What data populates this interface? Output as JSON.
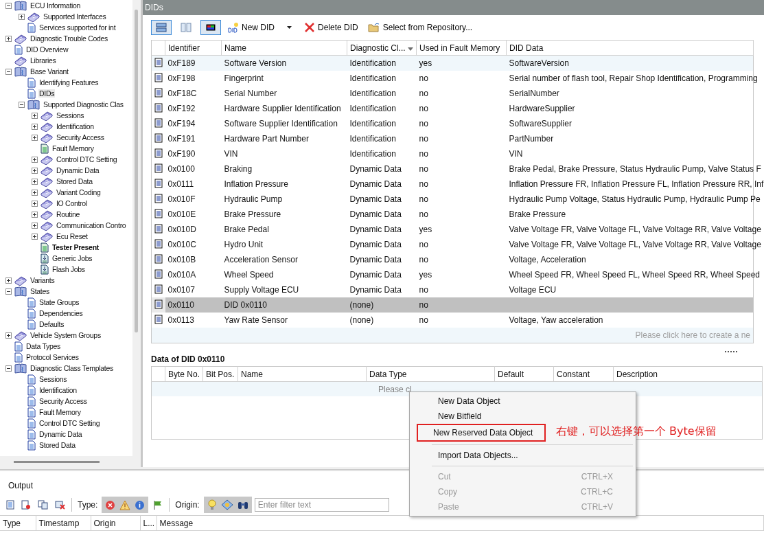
{
  "tree": [
    {
      "label": "ECU Information",
      "kind": "book-open",
      "expanded": true,
      "bold": false,
      "selected": false,
      "children": [
        {
          "label": "Supported Interfaces",
          "kind": "book",
          "expanded": false,
          "bold": false,
          "selected": false
        },
        {
          "label": "Services supported for int",
          "kind": "doc",
          "bold": false,
          "selected": false
        }
      ]
    },
    {
      "label": "Diagnostic Trouble Codes",
      "kind": "book",
      "expanded": false,
      "bold": false,
      "selected": false
    },
    {
      "label": "DID Overview",
      "kind": "doc",
      "bold": false,
      "selected": false
    },
    {
      "label": "Libraries",
      "kind": "book",
      "bold": false,
      "selected": false
    },
    {
      "label": "Base Variant",
      "kind": "book-open",
      "expanded": true,
      "bold": false,
      "selected": false,
      "children": [
        {
          "label": "Identifying Features",
          "kind": "doc",
          "bold": false,
          "selected": false
        },
        {
          "label": "DIDs",
          "kind": "doc",
          "bold": false,
          "selected": true
        },
        {
          "label": "Supported Diagnostic Clas",
          "kind": "book-open",
          "expanded": true,
          "bold": false,
          "selected": false,
          "children": [
            {
              "label": "Sessions",
              "kind": "book",
              "expanded": false,
              "bold": false,
              "selected": false
            },
            {
              "label": "Identification",
              "kind": "book",
              "expanded": false,
              "bold": false,
              "selected": false
            },
            {
              "label": "Security Access",
              "kind": "book",
              "expanded": false,
              "bold": false,
              "selected": false
            },
            {
              "label": "Fault Memory",
              "kind": "doc-green",
              "bold": false,
              "selected": false
            },
            {
              "label": "Control DTC Setting",
              "kind": "book",
              "expanded": false,
              "bold": false,
              "selected": false
            },
            {
              "label": "Dynamic Data",
              "kind": "book",
              "expanded": false,
              "bold": false,
              "selected": false
            },
            {
              "label": "Stored Data",
              "kind": "book",
              "expanded": false,
              "bold": false,
              "selected": false
            },
            {
              "label": "Variant Coding",
              "kind": "book",
              "expanded": false,
              "bold": false,
              "selected": false
            },
            {
              "label": "IO Control",
              "kind": "book",
              "expanded": false,
              "bold": false,
              "selected": false
            },
            {
              "label": "Routine",
              "kind": "book",
              "expanded": false,
              "bold": false,
              "selected": false
            },
            {
              "label": "Communication Contro",
              "kind": "book",
              "expanded": false,
              "bold": false,
              "selected": false
            },
            {
              "label": "Ecu Reset",
              "kind": "book",
              "expanded": false,
              "bold": false,
              "selected": false
            },
            {
              "label": "Tester Present",
              "kind": "doc-green",
              "bold": true,
              "selected": false
            },
            {
              "label": "Generic Jobs",
              "kind": "job",
              "bold": false,
              "selected": false
            },
            {
              "label": "Flash Jobs",
              "kind": "job",
              "bold": false,
              "selected": false
            }
          ]
        }
      ]
    },
    {
      "label": "Variants",
      "kind": "book",
      "expanded": false,
      "bold": false,
      "selected": false
    },
    {
      "label": "States",
      "kind": "book-open",
      "expanded": true,
      "bold": false,
      "selected": false,
      "children": [
        {
          "label": "State Groups",
          "kind": "doc",
          "bold": false,
          "selected": false
        },
        {
          "label": "Dependencies",
          "kind": "doc",
          "bold": false,
          "selected": false
        },
        {
          "label": "Defaults",
          "kind": "doc",
          "bold": false,
          "selected": false
        }
      ]
    },
    {
      "label": "Vehicle System Groups",
      "kind": "book",
      "expanded": false,
      "bold": false,
      "selected": false
    },
    {
      "label": "Data Types",
      "kind": "doc",
      "bold": false,
      "selected": false
    },
    {
      "label": "Protocol Services",
      "kind": "doc",
      "bold": false,
      "selected": false
    },
    {
      "label": "Diagnostic Class Templates",
      "kind": "book-open",
      "expanded": true,
      "bold": false,
      "selected": false,
      "children": [
        {
          "label": "Sessions",
          "kind": "doc",
          "bold": false,
          "selected": false
        },
        {
          "label": "Identification",
          "kind": "doc",
          "bold": false,
          "selected": false
        },
        {
          "label": "Security Access",
          "kind": "doc",
          "bold": false,
          "selected": false
        },
        {
          "label": "Fault Memory",
          "kind": "doc",
          "bold": false,
          "selected": false
        },
        {
          "label": "Control DTC Setting",
          "kind": "doc",
          "bold": false,
          "selected": false
        },
        {
          "label": "Dynamic Data",
          "kind": "doc",
          "bold": false,
          "selected": false
        },
        {
          "label": "Stored Data",
          "kind": "doc",
          "bold": false,
          "selected": false
        }
      ]
    }
  ],
  "panel": {
    "title": "DIDs"
  },
  "toolbar": {
    "views": [
      {
        "kind": "rows",
        "selected": true
      },
      {
        "kind": "columns",
        "selected": false
      },
      {
        "kind": "color",
        "selected": true
      }
    ],
    "buttons": [
      {
        "kind": "new",
        "label": "New DID"
      },
      {
        "kind": "delete",
        "label": "Delete DID"
      },
      {
        "kind": "repository",
        "label": "Select from Repository..."
      }
    ]
  },
  "did_table": {
    "columns": [
      "Identifier",
      "Name",
      "Diagnostic Cl...",
      "Used in Fault Memory",
      "DID Data"
    ],
    "rows": [
      {
        "cells": [
          "0xF189",
          "Software Version",
          "Identification",
          "yes",
          "SoftwareVersion"
        ],
        "selected": false,
        "hover": true
      },
      {
        "cells": [
          "0xF198",
          "Fingerprint",
          "Identification",
          "no",
          "Serial number of flash tool, Repair Shop Identification, Programming"
        ],
        "selected": false,
        "hover": false
      },
      {
        "cells": [
          "0xF18C",
          "Serial Number",
          "Identification",
          "no",
          "SerialNumber"
        ],
        "selected": false,
        "hover": false
      },
      {
        "cells": [
          "0xF192",
          "Hardware Supplier Identification",
          "Identification",
          "no",
          "HardwareSupplier"
        ],
        "selected": false,
        "hover": false
      },
      {
        "cells": [
          "0xF194",
          "Software Supplier Identification",
          "Identification",
          "no",
          "SoftwareSupplier"
        ],
        "selected": false,
        "hover": false
      },
      {
        "cells": [
          "0xF191",
          "Hardware Part Number",
          "Identification",
          "no",
          "PartNumber"
        ],
        "selected": false,
        "hover": false
      },
      {
        "cells": [
          "0xF190",
          "VIN",
          "Identification",
          "no",
          "VIN"
        ],
        "selected": false,
        "hover": false
      },
      {
        "cells": [
          "0x0100",
          "Braking",
          "Dynamic Data",
          "no",
          "Brake Pedal, Brake Pressure, Status Hydraulic Pump, Valve Status F"
        ],
        "selected": false,
        "hover": false
      },
      {
        "cells": [
          "0x0111",
          "Inflation Pressure",
          "Dynamic Data",
          "no",
          "Inflation Pressure FR, Inflation Pressure FL, Inflation Pressure RR, Inf"
        ],
        "selected": false,
        "hover": false
      },
      {
        "cells": [
          "0x010F",
          "Hydraulic Pump",
          "Dynamic Data",
          "no",
          "Hydraulic Pump Voltage, Status Hydraulic Pump, Hydraulic Pump Pe"
        ],
        "selected": false,
        "hover": false
      },
      {
        "cells": [
          "0x010E",
          "Brake Pressure",
          "Dynamic Data",
          "no",
          "Brake Pressure"
        ],
        "selected": false,
        "hover": false
      },
      {
        "cells": [
          "0x010D",
          "Brake Pedal",
          "Dynamic Data",
          "yes",
          "Valve Voltage FR, Valve Voltage FL, Valve Voltage RR, Valve Voltage"
        ],
        "selected": false,
        "hover": false
      },
      {
        "cells": [
          "0x010C",
          "Hydro Unit",
          "Dynamic Data",
          "no",
          "Valve Voltage FR, Valve Voltage FL, Valve Voltage RR, Valve Voltage"
        ],
        "selected": false,
        "hover": false
      },
      {
        "cells": [
          "0x010B",
          "Acceleration Sensor",
          "Dynamic Data",
          "no",
          "Voltage, Acceleration"
        ],
        "selected": false,
        "hover": false
      },
      {
        "cells": [
          "0x010A",
          "Wheel Speed",
          "Dynamic Data",
          "yes",
          "Wheel Speed FR, Wheel Speed FL, Wheel Speed RR, Wheel Speed"
        ],
        "selected": false,
        "hover": false
      },
      {
        "cells": [
          "0x0107",
          "Supply Voltage ECU",
          "Dynamic Data",
          "no",
          "Voltage ECU"
        ],
        "selected": false,
        "hover": false
      },
      {
        "cells": [
          "0x0110",
          "DID 0x0110",
          "(none)",
          "no",
          null
        ],
        "selected": true,
        "hover": false
      },
      {
        "cells": [
          "0x0113",
          "Yaw Rate Sensor",
          "(none)",
          "no",
          "Voltage, Yaw acceleration"
        ],
        "selected": false,
        "hover": false
      }
    ],
    "new_row_hint": "Please click here to create a ne"
  },
  "data_section": {
    "title": "Data of DID 0x0110",
    "columns": [
      "Byte No.",
      "Bit Pos.",
      "Name",
      "Data Type",
      "Default",
      "Constant",
      "Description"
    ],
    "new_row_hint": "Please cl"
  },
  "context_menu": [
    {
      "kind": "item",
      "label": "New Data Object",
      "disabled": false,
      "marked": false
    },
    {
      "kind": "item",
      "label": "New Bitfield",
      "disabled": false,
      "marked": false
    },
    {
      "kind": "item",
      "label": "New Reserved Data Object",
      "disabled": false,
      "marked": true
    },
    {
      "kind": "separator"
    },
    {
      "kind": "item",
      "label": "Import Data Objects...",
      "disabled": false,
      "marked": false
    },
    {
      "kind": "separator"
    },
    {
      "kind": "item",
      "label": "Cut",
      "shortcut": "CTRL+X",
      "disabled": true,
      "marked": false
    },
    {
      "kind": "item",
      "label": "Copy",
      "shortcut": "CTRL+C",
      "disabled": true,
      "marked": false
    },
    {
      "kind": "item",
      "label": "Paste",
      "shortcut": "CTRL+V",
      "disabled": true,
      "marked": false
    }
  ],
  "annotation": "右键，可以选择第一个 Byte保留",
  "output": {
    "title": "Output",
    "type_label": "Type:",
    "origin_label": "Origin:",
    "filter": {
      "placeholder": "Enter filter text"
    },
    "columns": [
      "Type",
      "Timestamp",
      "Origin",
      "L...",
      "Message"
    ]
  }
}
